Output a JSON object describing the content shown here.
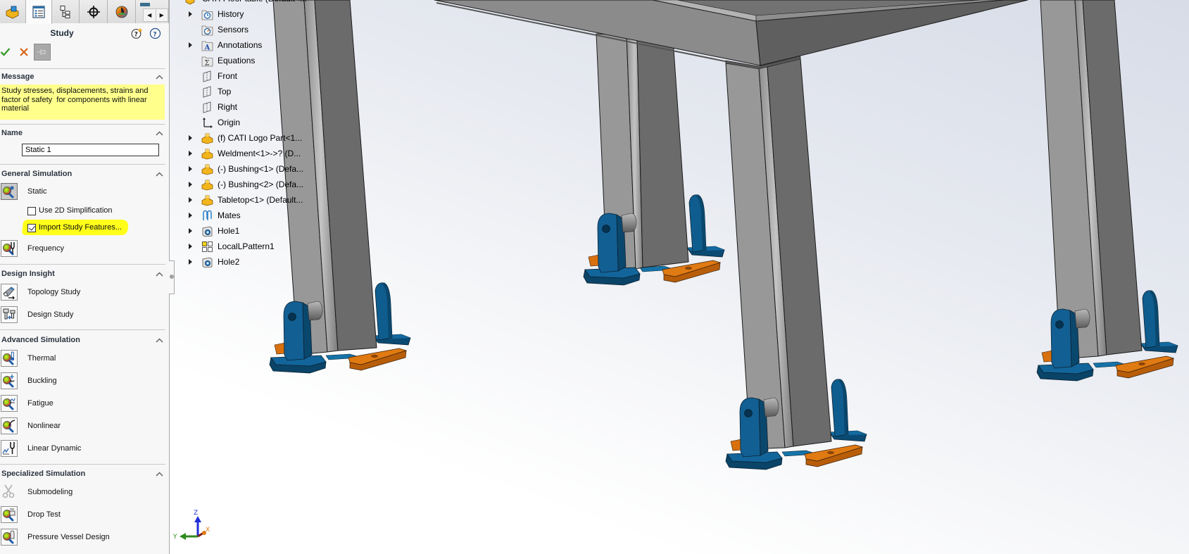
{
  "property_manager": {
    "tabs": [
      {
        "id": "featuremanager",
        "icon": "part-icon",
        "active": false
      },
      {
        "id": "propertymanager",
        "icon": "property-manager-icon",
        "active": true
      },
      {
        "id": "configurationmanager",
        "icon": "configuration-manager-icon",
        "active": false
      },
      {
        "id": "dimxpertmanager",
        "icon": "dimxpert-icon",
        "active": false
      },
      {
        "id": "displaymanager",
        "icon": "display-manager-icon",
        "active": false
      },
      {
        "id": "simulation",
        "icon": "simulation-tab-icon",
        "active": false
      }
    ],
    "tab_scroll": {
      "left": "◀",
      "right": "▶"
    },
    "title": "Study",
    "help_icons": [
      "whats-new-help-icon",
      "help-icon"
    ],
    "actions": [
      "ok-check-icon",
      "cancel-x-icon",
      "keep-visible-pin-icon"
    ],
    "message": {
      "header": "Message",
      "text_lines": [
        "Study stresses, displacements, strains and",
        "factor of safety  for components with linear",
        "material"
      ]
    },
    "name": {
      "header": "Name",
      "value": "Static 1"
    },
    "sections": [
      {
        "header": "General Simulation",
        "items": [
          {
            "label": "Static",
            "icon": "static-study-icon",
            "selected": true
          },
          {
            "label": "Frequency",
            "icon": "frequency-study-icon",
            "selected": false
          }
        ],
        "options": [
          {
            "label": "Use 2D Simplification",
            "checked": false,
            "highlighted": false
          },
          {
            "label": "Import Study Features...",
            "checked": true,
            "highlighted": true
          }
        ]
      },
      {
        "header": "Design Insight",
        "items": [
          {
            "label": "Topology Study",
            "icon": "topology-study-icon"
          },
          {
            "label": "Design Study",
            "icon": "design-study-icon"
          }
        ]
      },
      {
        "header": "Advanced Simulation",
        "items": [
          {
            "label": "Thermal",
            "icon": "thermal-study-icon"
          },
          {
            "label": "Buckling",
            "icon": "buckling-study-icon"
          },
          {
            "label": "Fatigue",
            "icon": "fatigue-study-icon"
          },
          {
            "label": "Nonlinear",
            "icon": "nonlinear-study-icon"
          },
          {
            "label": "Linear Dynamic",
            "icon": "linear-dynamic-study-icon"
          }
        ]
      },
      {
        "header": "Specialized Simulation",
        "items": [
          {
            "label": "Submodeling",
            "icon": "submodeling-icon",
            "disabled": true
          },
          {
            "label": "Drop Test",
            "icon": "drop-test-icon"
          },
          {
            "label": "Pressure Vessel Design",
            "icon": "pressure-vessel-icon"
          }
        ]
      }
    ]
  },
  "feature_tree": {
    "items": [
      {
        "label": "CATI Floor table (Default<...",
        "icon": "assembly-icon",
        "expandable": false
      },
      {
        "label": "History",
        "icon": "history-folder-icon",
        "expandable": true
      },
      {
        "label": "Sensors",
        "icon": "sensors-folder-icon",
        "expandable": false
      },
      {
        "label": "Annotations",
        "icon": "annotations-folder-icon",
        "expandable": true
      },
      {
        "label": "Equations",
        "icon": "equations-folder-icon",
        "expandable": false
      },
      {
        "label": "Front",
        "icon": "plane-icon",
        "expandable": false
      },
      {
        "label": "Top",
        "icon": "plane-icon",
        "expandable": false
      },
      {
        "label": "Right",
        "icon": "plane-icon",
        "expandable": false
      },
      {
        "label": "Origin",
        "icon": "origin-icon",
        "expandable": false
      },
      {
        "label": "(f) CATI Logo Part<1...",
        "icon": "part-component-icon",
        "expandable": true
      },
      {
        "label": "Weldment<1>->? (D...",
        "icon": "part-component-icon",
        "expandable": true
      },
      {
        "label": "(-) Bushing<1> (Defa...",
        "icon": "part-component-icon",
        "expandable": true
      },
      {
        "label": "(-) Bushing<2> (Defa...",
        "icon": "part-component-icon",
        "expandable": true
      },
      {
        "label": "Tabletop<1> (Default...",
        "icon": "part-component-icon",
        "expandable": true
      },
      {
        "label": "Mates",
        "icon": "mates-icon",
        "expandable": true
      },
      {
        "label": "Hole1",
        "icon": "hole-feature-icon",
        "expandable": true
      },
      {
        "label": "LocalLPattern1",
        "icon": "pattern-icon",
        "expandable": true
      },
      {
        "label": "Hole2",
        "icon": "hole-feature-icon",
        "expandable": true
      }
    ]
  },
  "viewport": {
    "model": "floor table assembly with four legs and clevis foot brackets",
    "triad": {
      "x_label": "X",
      "y_label": "Y",
      "z_label": "Z"
    }
  },
  "colors": {
    "message_background": "#ffff8c",
    "highlight_marker": "#ffff1a",
    "ok": "#3a9b2e",
    "cancel": "#d8651c",
    "bracket_blue": "#11629a",
    "plate_orange": "#dc7410",
    "leg_gray": "#969696"
  }
}
